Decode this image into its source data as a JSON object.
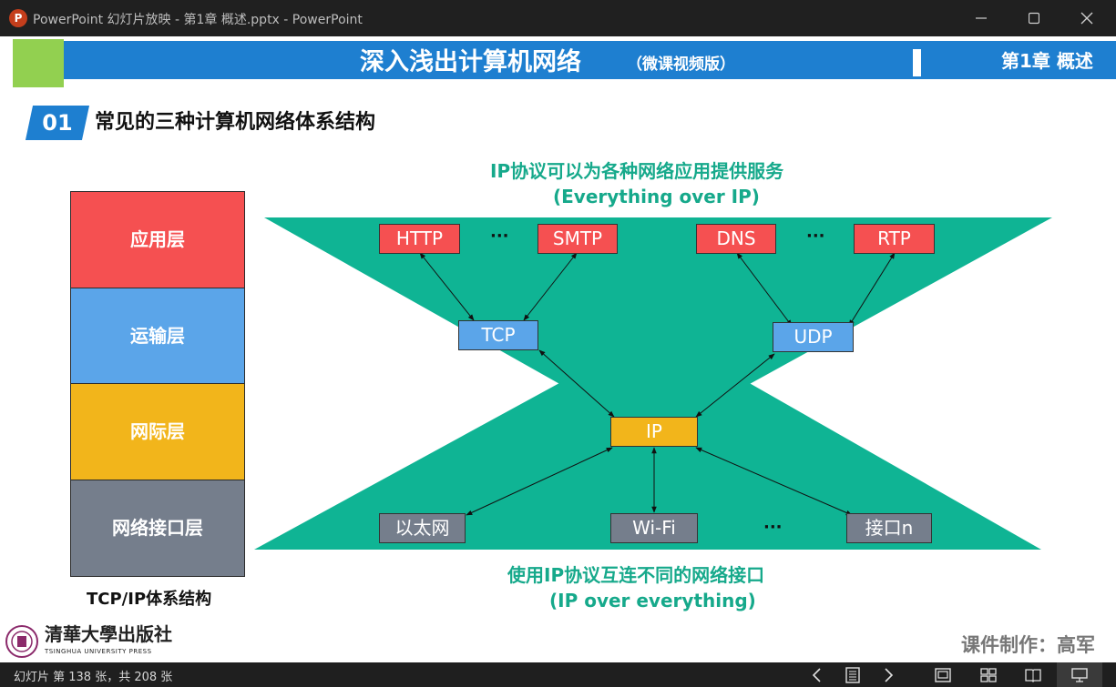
{
  "window": {
    "title": "PowerPoint 幻灯片放映  -  第1章 概述.pptx - PowerPoint",
    "app_icon_letter": "P"
  },
  "slide": {
    "course_title": "深入浅出计算机网络",
    "course_subtitle": "（微课视频版）",
    "chapter": "第1章 概述",
    "section_number": "01",
    "section_title": "常见的三种计算机网络体系结构",
    "layers": [
      "应用层",
      "运输层",
      "网际层",
      "网络接口层"
    ],
    "stack_caption": "TCP/IP体系结构",
    "top_caption_line1": "IP协议可以为各种网络应用提供服务",
    "top_caption_line2": "(Everything over IP)",
    "bottom_caption_line1": "使用IP协议互连不同的网络接口",
    "bottom_caption_line2": "(IP over everything)",
    "app_protocols": [
      "HTTP",
      "SMTP",
      "DNS",
      "RTP"
    ],
    "transport_protocols": [
      "TCP",
      "UDP"
    ],
    "network_protocol": "IP",
    "interfaces": [
      "以太网",
      "Wi-Fi",
      "接口n"
    ],
    "ellipsis": "···",
    "ellipsis_bottom": "···",
    "publisher_logo_text": "清華大學出版社",
    "publisher_logo_en": "TSINGHUA UNIVERSITY PRESS",
    "maker": "课件制作：高军",
    "colors": {
      "header_blue": "#1e7fd0",
      "teal": "#0fb494",
      "teal_text": "#16a98b",
      "app_red": "#f55051",
      "transport_blue": "#5ba5e9",
      "network_yellow": "#f2b51b",
      "interface_gray": "#757e8c"
    }
  },
  "status": {
    "slide_counter": "幻灯片 第 138 张，共 208 张",
    "icons": [
      "prev-icon",
      "notes-icon",
      "next-icon",
      "normal-view-icon",
      "slide-sorter-icon",
      "reading-view-icon",
      "slideshow-icon"
    ]
  }
}
